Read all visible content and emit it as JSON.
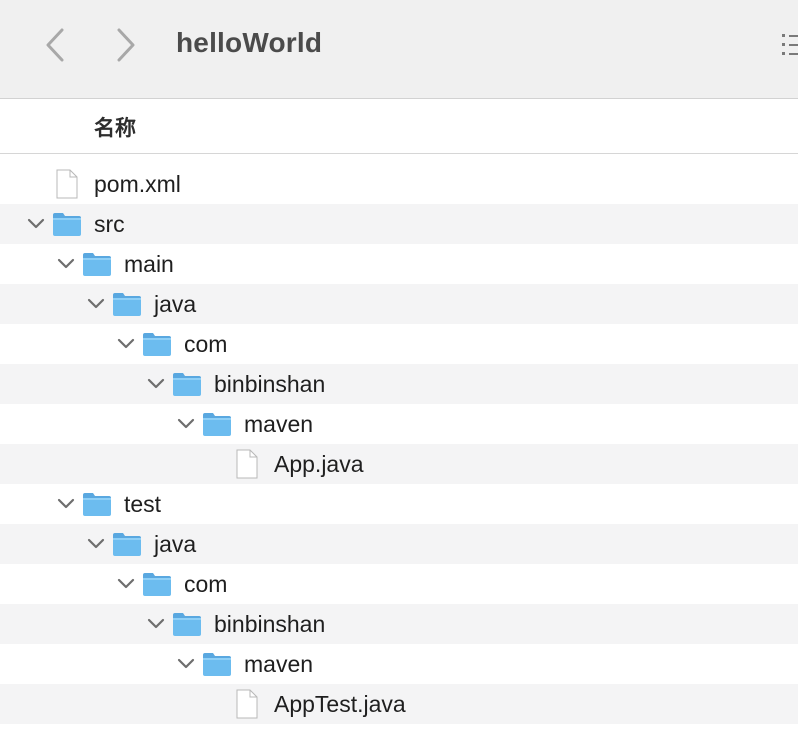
{
  "window": {
    "title": "helloWorld"
  },
  "header": {
    "name_column": "名称"
  },
  "files": [
    {
      "name": "pom.xml",
      "kind": "file",
      "depth": 0,
      "expanded": false
    },
    {
      "name": "src",
      "kind": "folder",
      "depth": 0,
      "expanded": true
    },
    {
      "name": "main",
      "kind": "folder",
      "depth": 1,
      "expanded": true
    },
    {
      "name": "java",
      "kind": "folder",
      "depth": 2,
      "expanded": true
    },
    {
      "name": "com",
      "kind": "folder",
      "depth": 3,
      "expanded": true
    },
    {
      "name": "binbinshan",
      "kind": "folder",
      "depth": 4,
      "expanded": true
    },
    {
      "name": "maven",
      "kind": "folder",
      "depth": 5,
      "expanded": true
    },
    {
      "name": "App.java",
      "kind": "file",
      "depth": 6,
      "expanded": false
    },
    {
      "name": "test",
      "kind": "folder",
      "depth": 1,
      "expanded": true
    },
    {
      "name": "java",
      "kind": "folder",
      "depth": 2,
      "expanded": true
    },
    {
      "name": "com",
      "kind": "folder",
      "depth": 3,
      "expanded": true
    },
    {
      "name": "binbinshan",
      "kind": "folder",
      "depth": 4,
      "expanded": true
    },
    {
      "name": "maven",
      "kind": "folder",
      "depth": 5,
      "expanded": true
    },
    {
      "name": "AppTest.java",
      "kind": "file",
      "depth": 6,
      "expanded": false
    }
  ],
  "colors": {
    "folder_body": "#6cbcef",
    "folder_tab": "#5aa8e0",
    "row_alt": "#f4f4f5",
    "toolbar": "#f0f0f0"
  }
}
